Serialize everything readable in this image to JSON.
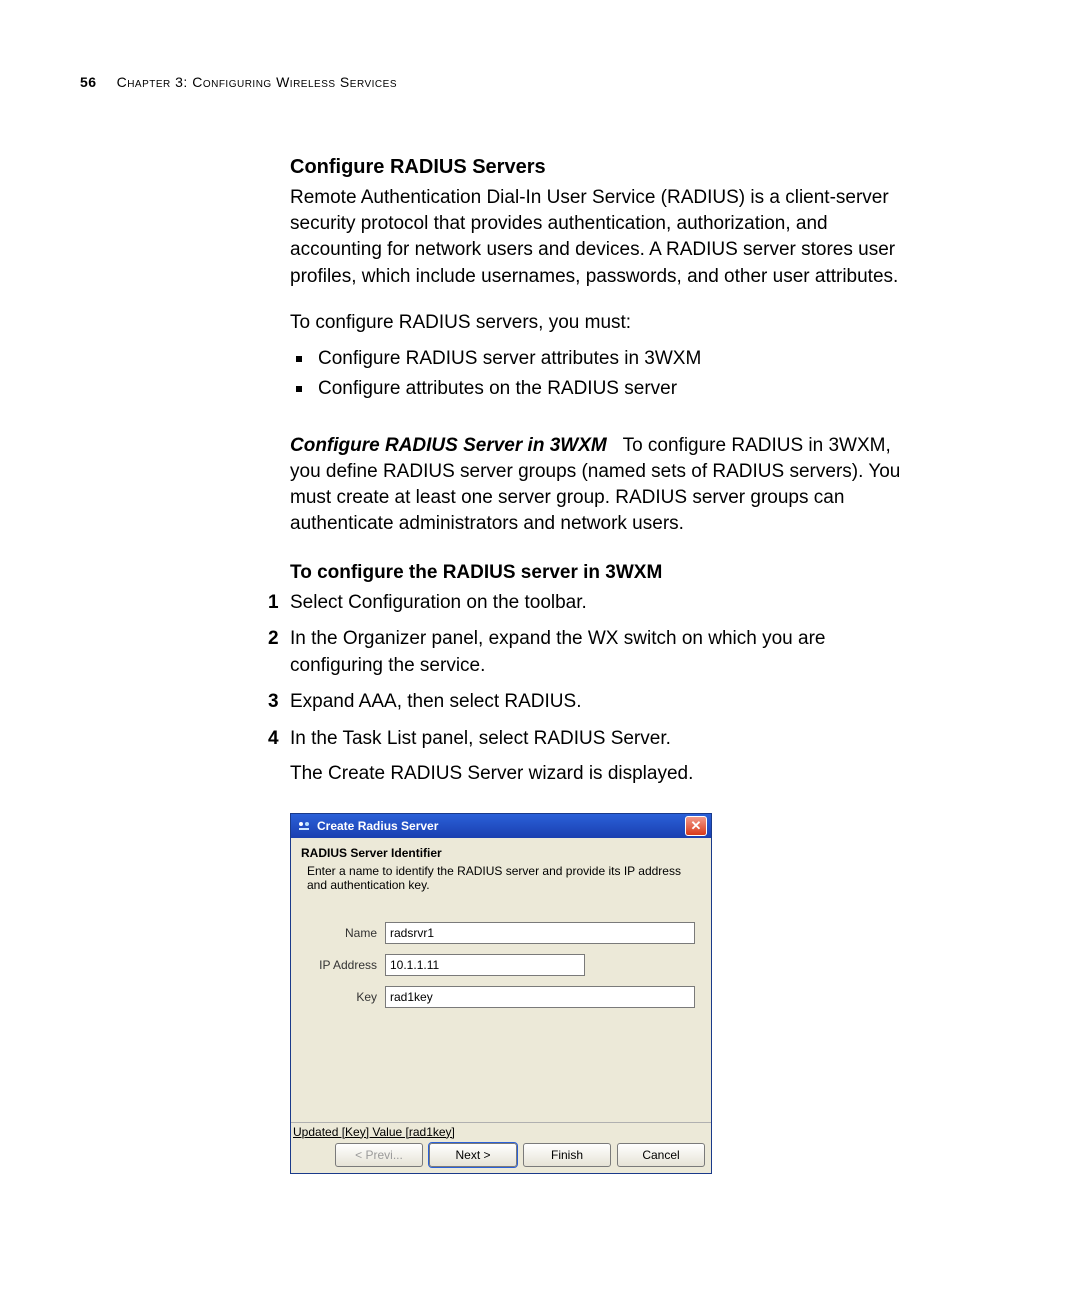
{
  "page": {
    "number": "56",
    "chapter_line": "Chapter 3: Configuring Wireless Services"
  },
  "section": {
    "heading": "Configure RADIUS Servers",
    "intro": "Remote Authentication Dial-In User Service (RADIUS) is a client-server security protocol that provides authentication, authorization, and accounting for network users and devices. A RADIUS server stores user profiles, which include usernames, passwords, and other user attributes.",
    "lead": "To configure RADIUS servers, you must:",
    "bullets": [
      "Configure RADIUS server attributes in 3WXM",
      "Configure attributes on the RADIUS server"
    ],
    "runin_title": "Configure RADIUS Server in 3WXM",
    "runin_body": "To configure RADIUS in 3WXM, you define RADIUS server groups (named sets of RADIUS servers). You must create at least one server group. RADIUS server groups can authenticate administrators and network users.",
    "sub_heading": "To configure the RADIUS server in 3WXM",
    "steps": [
      "Select Configuration on the toolbar.",
      "In the Organizer panel, expand the WX switch on which you are configuring the service.",
      "Expand AAA, then select RADIUS.",
      "In the Task List panel, select RADIUS Server."
    ],
    "after_steps": "The Create RADIUS Server wizard is displayed."
  },
  "dialog": {
    "title": "Create Radius Server",
    "close_glyph": "✕",
    "subtitle": "RADIUS Server Identifier",
    "description": "Enter a name to identify the RADIUS server and provide its IP address and authentication key.",
    "fields": {
      "name_label": "Name",
      "name_value": "radsrvr1",
      "ip_label": "IP Address",
      "ip_value": "10.1.1.11",
      "key_label": "Key",
      "key_value": "rad1key"
    },
    "status": "Updated [Key] Value [rad1key]",
    "buttons": {
      "prev": "< Previ...",
      "next": "Next >",
      "finish": "Finish",
      "cancel": "Cancel"
    }
  }
}
